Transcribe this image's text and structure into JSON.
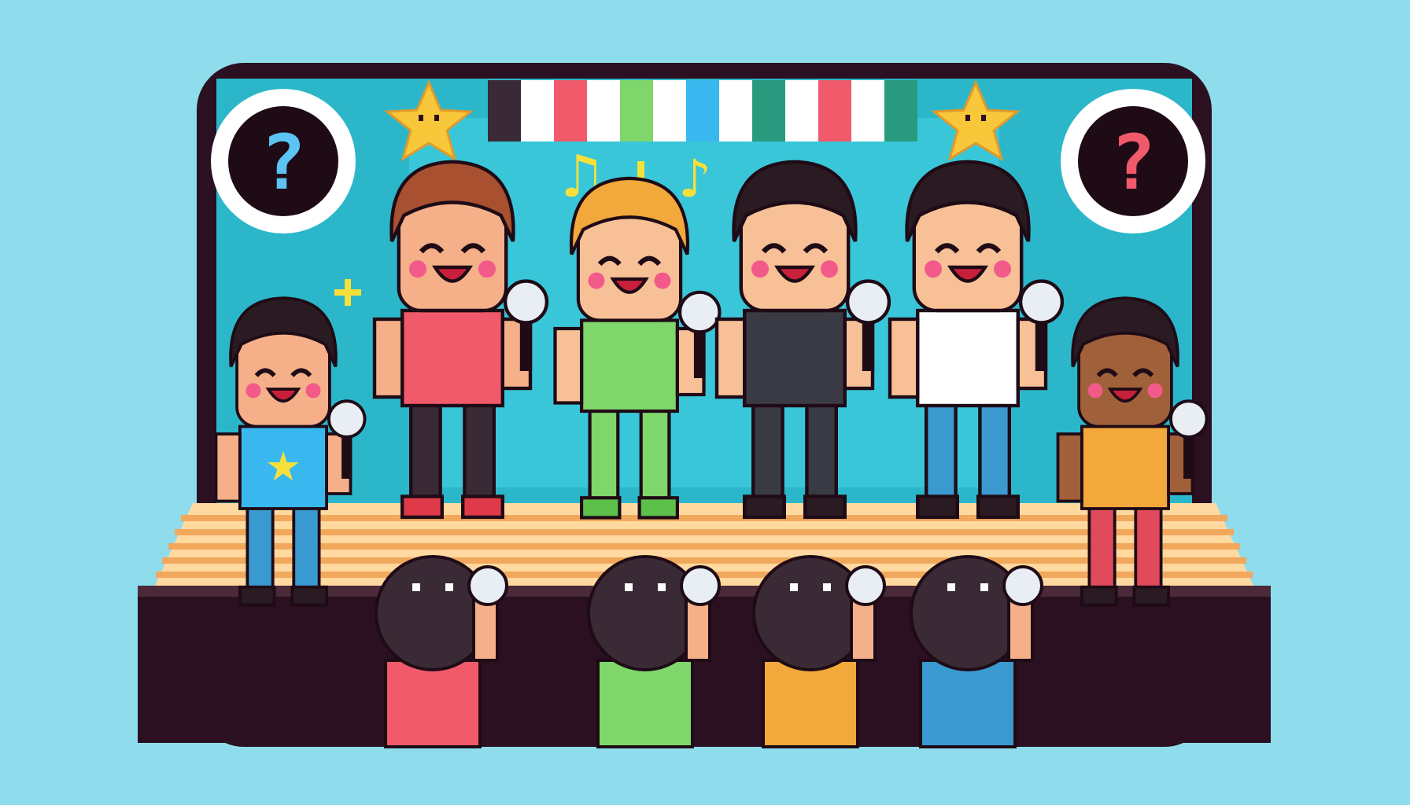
{
  "scene": {
    "background_color": "#8fdcec",
    "frame_color": "#2a1020",
    "wall_color": "#2bb7c9",
    "wall_light": "#39c6d8",
    "floor_light": "#ffd9a0",
    "floor_dark": "#f2a85c",
    "outline_color": "#1e0b16"
  },
  "signs": [
    {
      "id": "left",
      "glyph": "?",
      "color": "#5cc4f2"
    },
    {
      "id": "right",
      "glyph": "?",
      "color": "#f05a6a"
    }
  ],
  "banner_colors": [
    "#3a2a35",
    "#ffffff",
    "#f05a6a",
    "#ffffff",
    "#7fd66a",
    "#ffffff",
    "#39b8f0",
    "#ffffff",
    "#2a9a7e",
    "#ffffff",
    "#f05a6a",
    "#ffffff",
    "#2a9a7e"
  ],
  "music_notes": [
    "♫",
    "♪"
  ],
  "performers": [
    {
      "name": "performer-1",
      "hair": "#2a1a22",
      "skin": "#f5b08a",
      "shirt": "#39b8f0",
      "pants": "#3a9ad0",
      "shoes": "#2a1a22",
      "emblem": "★"
    },
    {
      "name": "performer-2",
      "hair": "#a85030",
      "skin": "#f5b08a",
      "shirt": "#f05a6a",
      "pants": "#3a2a35",
      "shoes": "#e03a4a",
      "emblem": ""
    },
    {
      "name": "performer-3",
      "hair": "#f2a83a",
      "skin": "#f8c096",
      "shirt": "#7fd66a",
      "pants": "#7fd66a",
      "shoes": "#5cc04a",
      "emblem": ""
    },
    {
      "name": "performer-4",
      "hair": "#2a1a22",
      "skin": "#f8c096",
      "shirt": "#3a3a44",
      "pants": "#3a3a44",
      "shoes": "#2a1a22",
      "emblem": ""
    },
    {
      "name": "performer-5",
      "hair": "#2a1a22",
      "skin": "#f8c096",
      "shirt": "#ffffff",
      "pants": "#3a9ad0",
      "shoes": "#2a1a22",
      "emblem": ""
    },
    {
      "name": "performer-6",
      "hair": "#2a1a22",
      "skin": "#a0603a",
      "shirt": "#f2a83a",
      "pants": "#e04a5a",
      "shoes": "#2a1a22",
      "emblem": ""
    }
  ],
  "audience": [
    {
      "name": "audience-1",
      "shirt": "#f05a6a"
    },
    {
      "name": "audience-2",
      "shirt": "#7fd66a"
    },
    {
      "name": "audience-3",
      "shirt": "#f2a83a"
    },
    {
      "name": "audience-4",
      "shirt": "#3a9ad0"
    }
  ]
}
